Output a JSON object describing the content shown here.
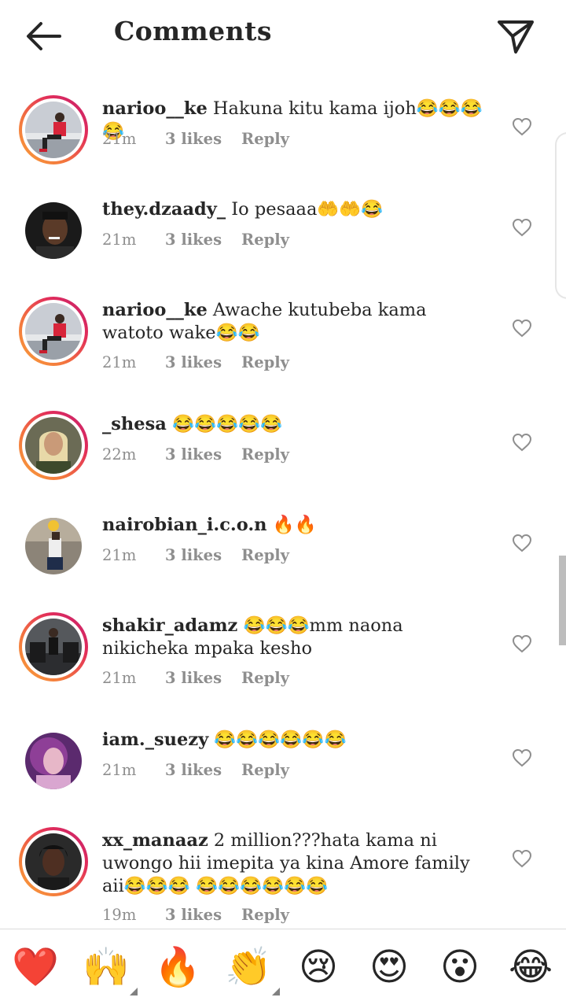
{
  "header": {
    "title": "Comments",
    "back_icon": "arrow-left-icon",
    "send_icon": "paper-plane-icon"
  },
  "comments": [
    {
      "username": "narioo__ke",
      "text": "Hakuna kitu kama ijoh😂😂😂😂",
      "time": "21m",
      "likes": "3 likes",
      "reply": "Reply"
    },
    {
      "username": "they.dzaady_",
      "text": "Io pesaaa🤲🤲😂",
      "time": "21m",
      "likes": "3 likes",
      "reply": "Reply"
    },
    {
      "username": "narioo__ke",
      "text": "Awache kutubeba kama watoto wake😂😂",
      "time": "21m",
      "likes": "3 likes",
      "reply": "Reply"
    },
    {
      "username": "_shesa",
      "text": "😂😂😂😂😂",
      "time": "22m",
      "likes": "3 likes",
      "reply": "Reply"
    },
    {
      "username": "nairobian_i.c.o.n",
      "text": "🔥🔥",
      "time": "21m",
      "likes": "3 likes",
      "reply": "Reply"
    },
    {
      "username": "shakir_adamz",
      "text": "😂😂😂mm naona nikicheka mpaka kesho",
      "time": "21m",
      "likes": "3 likes",
      "reply": "Reply"
    },
    {
      "username": "iam._suezy",
      "text": "😂😂😂😂😂😂",
      "time": "21m",
      "likes": "3 likes",
      "reply": "Reply"
    },
    {
      "username": "xx_manaaz",
      "text": "2 million???hata kama ni uwongo hii imepita ya kina Amore family aii😂😂😂 😂😂😂😂😂😂",
      "time": "19m",
      "likes": "3 likes",
      "reply": "Reply"
    }
  ],
  "emoji_bar": [
    "❤️",
    "🙌",
    "🔥",
    "👏",
    "😢",
    "😍",
    "😮",
    "😂"
  ],
  "colors": {
    "text": "#262626",
    "meta": "#8e8e8e",
    "divider": "#dbdbdb",
    "story_ring_start": "#f9a13a",
    "story_ring_end": "#c3216f"
  }
}
